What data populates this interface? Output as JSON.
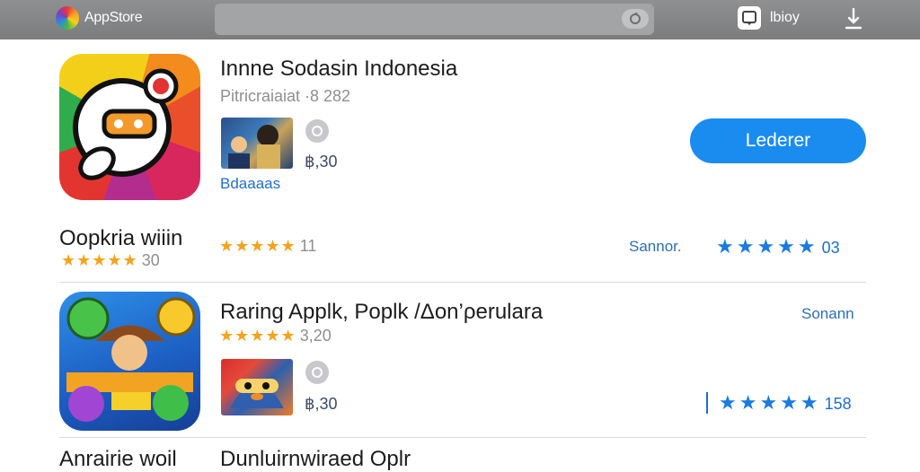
{
  "header": {
    "brand": "AppStore",
    "account_label": "lbioy"
  },
  "apps": [
    {
      "title": "Innne Sodasin Indonesia",
      "subtitle": "Pitricraiaiat ·8 282",
      "price": "฿,30",
      "developer_link": "Bdaaaas",
      "action_label": "Lederer"
    },
    {
      "title": "Raring Applk, Poplk /Δon’ρerulara",
      "rating_stars": "★★★★★",
      "rating_count": "3,20",
      "price": "฿,30",
      "see_all": "Sonann",
      "blue_stars": "★★★★★",
      "blue_count": "158"
    }
  ],
  "section": {
    "title": "Oopkria wiiin",
    "rating_stars": "★★★★★",
    "rating_count": "30",
    "mid_stars": "★★★★★",
    "mid_count": "11",
    "see_all": "Sannor.",
    "blue_stars": "★★★★★",
    "blue_count": "03"
  },
  "bottom": {
    "left_title": "Anrairie woil",
    "mid_title": "Dunluirnwiraed Oplr"
  },
  "colors": {
    "accent": "#1a8cf0",
    "star": "#f4a31c",
    "topbar": "#858688"
  },
  "icons": [
    "app-logo-icon",
    "search-icon",
    "account-icon",
    "download-icon",
    "info-icon"
  ]
}
